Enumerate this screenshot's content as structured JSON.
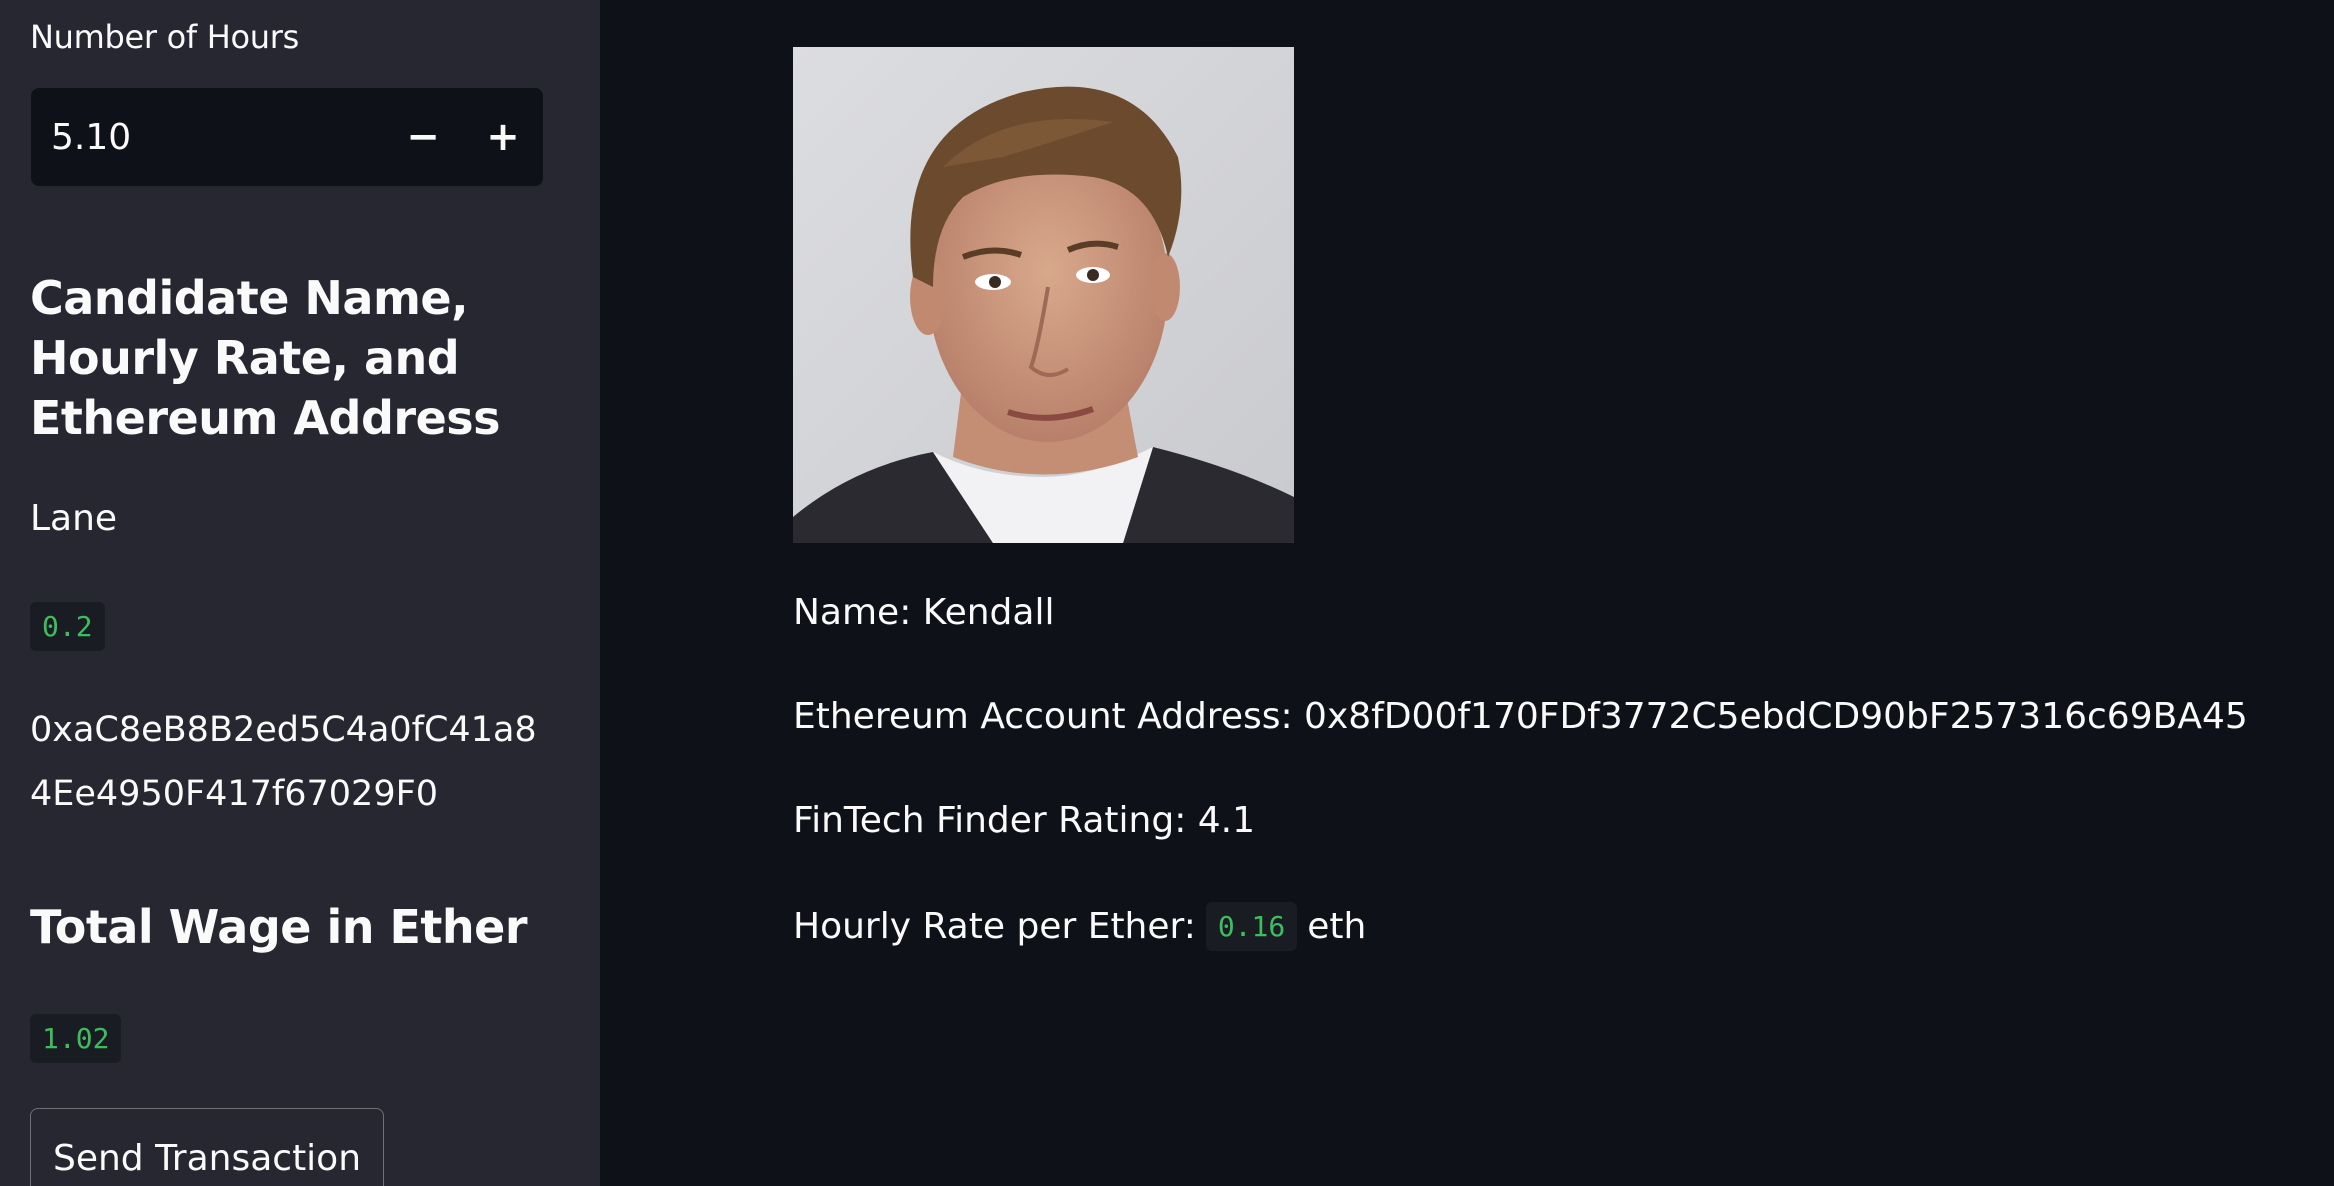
{
  "sidebar": {
    "hours_label": "Number of Hours",
    "hours_value": "5.10",
    "decrement_symbol": "−",
    "increment_symbol": "+",
    "heading": "Candidate Name, Hourly Rate, and Ethereum Address",
    "candidate_name": "Lane",
    "candidate_rate": "0.2",
    "candidate_address": "0xaC8eB8B2ed5C4a0fC41a84Ee4950F417f67029F0",
    "wage_heading": "Total Wage in Ether",
    "wage_value": "1.02",
    "send_button_label": "Send Transaction"
  },
  "main": {
    "portrait_icon": "person-photo",
    "name_line": "Name: Kendall",
    "address_line": "Ethereum Account Address: 0x8fD00f170FDf3772C5ebdCD90bF257316c69BA45",
    "rating_line": "FinTech Finder Rating: 4.1",
    "rate_label": "Hourly Rate per Ether:",
    "rate_value": "0.16",
    "rate_unit": "eth"
  },
  "colors": {
    "sidebar_bg": "#262730",
    "main_bg": "#0e1117",
    "code_text": "#3dbd5d",
    "text": "#fafafa"
  }
}
